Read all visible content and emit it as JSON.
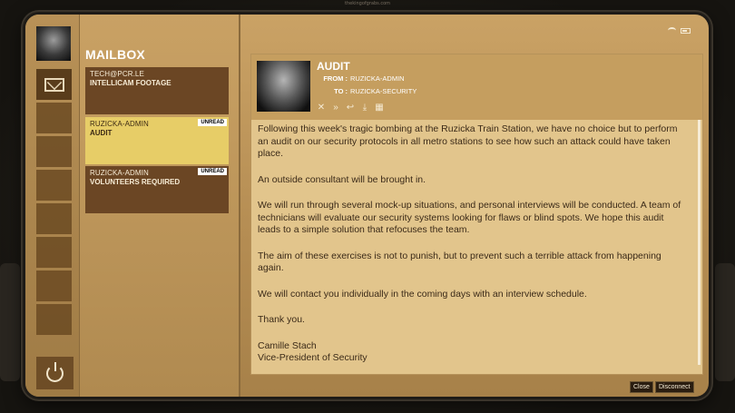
{
  "watermark": "thekingofgrabs.com",
  "mailbox": {
    "title": "MAILBOX",
    "messages": [
      {
        "from": "TECH@PCR.LE",
        "subject": "INTELLICAM FOOTAGE",
        "badge": ""
      },
      {
        "from": "RUZICKA-ADMIN",
        "subject": "AUDIT",
        "badge": "UNREAD"
      },
      {
        "from": "RUZICKA-ADMIN",
        "subject": "VOLUNTEERS REQUIRED",
        "badge": "UNREAD"
      }
    ]
  },
  "email": {
    "subject": "AUDIT",
    "from_label": "FROM :",
    "from": "RUZICKA-ADMIN",
    "to_label": "TO :",
    "to": "RUZICKA-SECURITY",
    "paragraphs": [
      "Following this week's tragic bombing at the Ruzicka Train Station, we have no choice but to perform an audit on our security protocols in all metro stations to see how such an attack could have taken place.",
      "An outside consultant will be brought in.",
      "We will run through several mock-up situations, and personal interviews will be conducted. A team of technicians will evaluate our security systems looking for flaws or blind spots. We hope this audit leads to a simple solution that refocuses the team.",
      "The aim of these exercises is not to punish, but to prevent such a terrible attack from happening again.",
      "We will contact you individually in the coming days with an interview schedule.",
      "Thank you."
    ],
    "signature_name": "Camille Stach",
    "signature_title": "Vice-President of Security"
  },
  "actions": {
    "close": "Close",
    "disconnect": "Disconnect"
  },
  "icons": {
    "toolbar": [
      "delete-icon",
      "forward-icon",
      "reply-icon",
      "download-icon",
      "calendar-icon"
    ]
  },
  "colors": {
    "selected_item": "#e7cd67",
    "item_bg": "#6b4624",
    "accent": "#c59e5f"
  }
}
